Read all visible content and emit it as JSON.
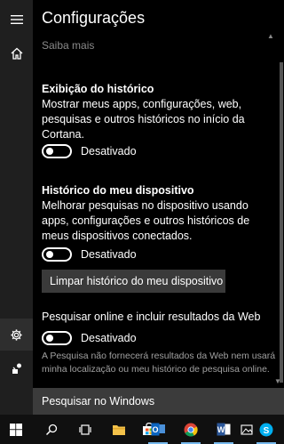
{
  "header": {
    "title": "Configurações"
  },
  "faded_link": "Saiba mais",
  "history_display": {
    "title": "Exibição do histórico",
    "description": "Mostrar meus apps, configurações, web, pesquisas e outros históricos no início da Cortana.",
    "toggle_state": "Desativado"
  },
  "device_history": {
    "title": "Histórico do meu dispositivo",
    "description": "Melhorar pesquisas no dispositivo usando apps, configurações e outros históricos de meus dispositivos conectados.",
    "toggle_state": "Desativado",
    "clear_button": "Limpar histórico do meu dispositivo"
  },
  "web_search": {
    "title": "Pesquisar online e incluir resultados da Web",
    "toggle_state": "Desativado",
    "note": "A Pesquisa não fornecerá resultados da Web nem usará minha localização ou meu histórico de pesquisa online."
  },
  "search_box": {
    "placeholder": "Pesquisar no Windows"
  },
  "rail_icons": [
    "hamburger-icon",
    "home-icon",
    "gear-icon",
    "feedback-icon"
  ],
  "taskbar_icons": [
    "windows-logo-icon",
    "search-icon",
    "task-view-icon",
    "file-explorer-icon",
    "store-icon",
    "outlook-icon",
    "chrome-icon",
    "word-icon",
    "photos-icon",
    "skype-icon"
  ],
  "colors": {
    "accent": "#76b9ed",
    "panel": "#000000",
    "rail": "#1f1f1f",
    "taskbar": "#101010",
    "search": "#3b3b3b"
  }
}
